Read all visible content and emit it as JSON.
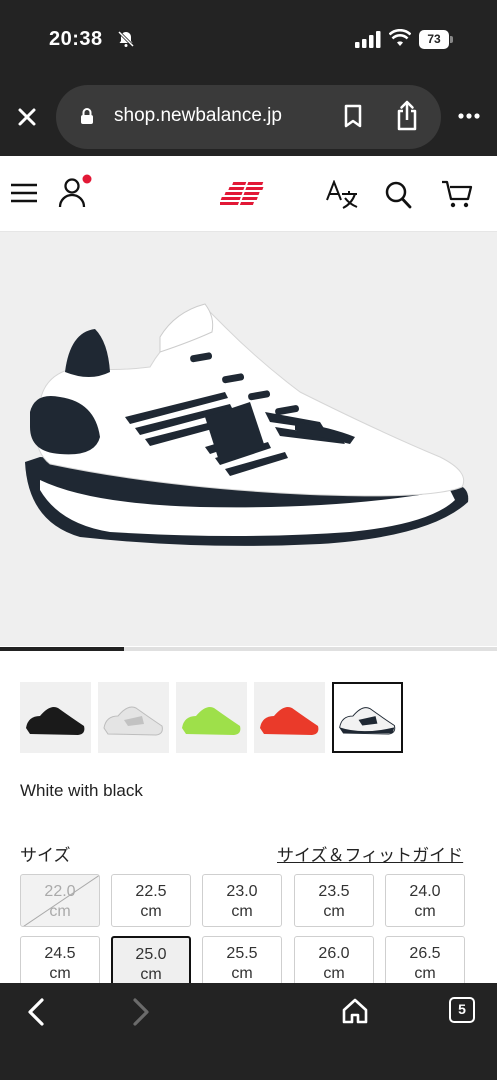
{
  "status": {
    "time": "20:38",
    "battery": "73"
  },
  "browser": {
    "url": "shop.newbalance.jp",
    "tab_count": "5"
  },
  "product": {
    "gallery_progress": 0.25,
    "thumbnails": [
      {
        "name": "black"
      },
      {
        "name": "white-grey"
      },
      {
        "name": "lime"
      },
      {
        "name": "red"
      },
      {
        "name": "white-with-black",
        "selected": true
      }
    ],
    "color_name": "White with black",
    "size_label": "サイズ",
    "size_guide": "サイズ＆フィットガイド",
    "sizes": [
      {
        "value": "22.0",
        "unit": "cm",
        "state": "disabled"
      },
      {
        "value": "22.5",
        "unit": "cm",
        "state": "available"
      },
      {
        "value": "23.0",
        "unit": "cm",
        "state": "available"
      },
      {
        "value": "23.5",
        "unit": "cm",
        "state": "available"
      },
      {
        "value": "24.0",
        "unit": "cm",
        "state": "available"
      },
      {
        "value": "24.5",
        "unit": "cm",
        "state": "available"
      },
      {
        "value": "25.0",
        "unit": "cm",
        "state": "selected"
      },
      {
        "value": "25.5",
        "unit": "cm",
        "state": "available"
      },
      {
        "value": "26.0",
        "unit": "cm",
        "state": "available"
      },
      {
        "value": "26.5",
        "unit": "cm",
        "state": "available"
      }
    ]
  },
  "colors": {
    "brand": "#e21836",
    "dark": "#232323",
    "notification": "#e21836"
  }
}
